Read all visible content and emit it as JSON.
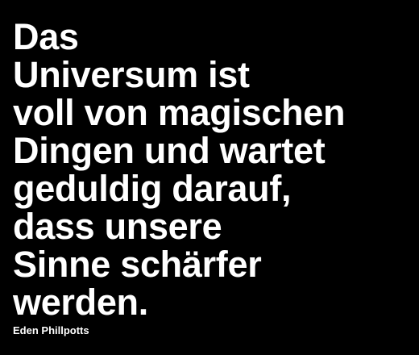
{
  "quote": {
    "lines": [
      "Das",
      "Universum ist",
      "voll von magischen",
      "Dingen und wartet",
      "geduldig darauf,",
      "dass unsere",
      "Sinne schärfer",
      "werden."
    ],
    "author": "Eden Phillpotts"
  },
  "colors": {
    "background": "#000000",
    "text": "#ffffff"
  }
}
